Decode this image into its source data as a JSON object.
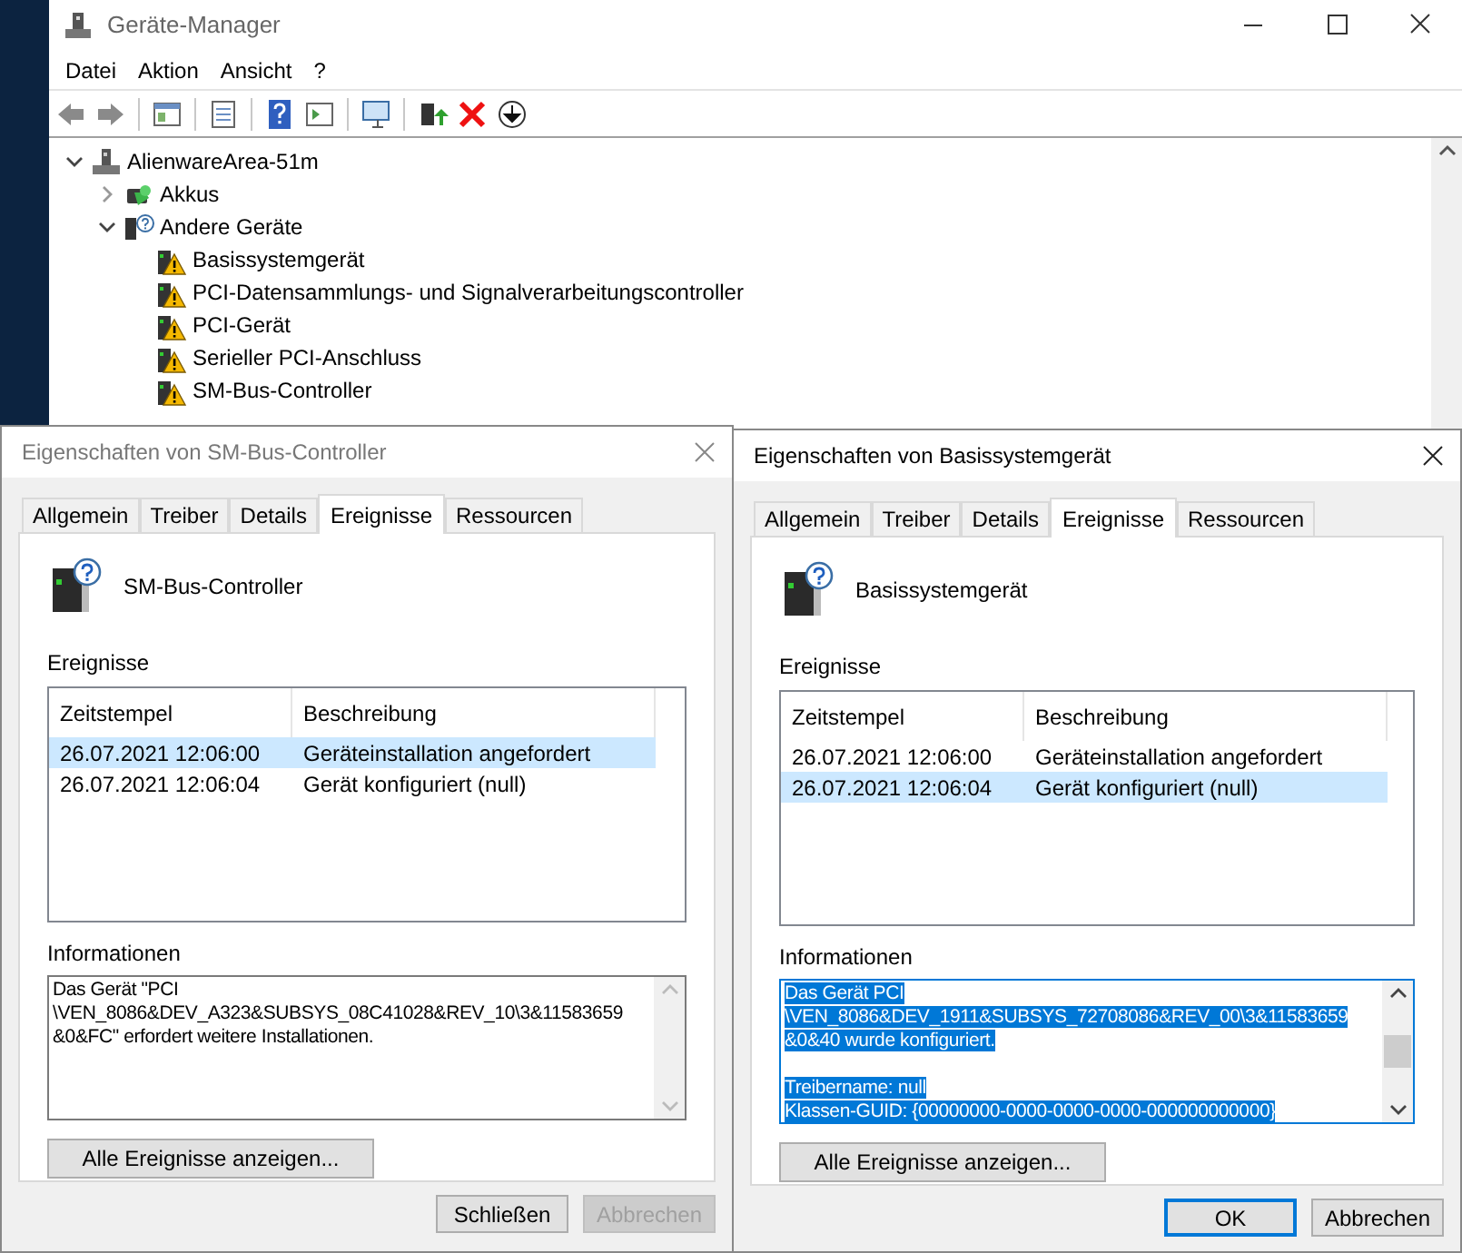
{
  "window": {
    "title": "Geräte-Manager"
  },
  "menu": [
    "Datei",
    "Aktion",
    "Ansicht",
    "?"
  ],
  "tree": {
    "label": "AlienwareArea-51m",
    "kind": "computer",
    "expanded": true,
    "children": [
      {
        "label": "Akkus",
        "kind": "battery",
        "expanded": false
      },
      {
        "label": "Andere Geräte",
        "kind": "unknown",
        "expanded": true,
        "children": [
          {
            "label": "Basissystemgerät",
            "kind": "warning"
          },
          {
            "label": "PCI-Datensammlungs- und Signalverarbeitungscontroller",
            "kind": "warning"
          },
          {
            "label": "PCI-Gerät",
            "kind": "warning"
          },
          {
            "label": "Serieller PCI-Anschluss",
            "kind": "warning"
          },
          {
            "label": "SM-Bus-Controller",
            "kind": "warning"
          }
        ]
      }
    ]
  },
  "dialogs": [
    {
      "title": "Eigenschaften von SM-Bus-Controller",
      "tabs": [
        {
          "label": "Allgemein",
          "selected": false
        },
        {
          "label": "Treiber",
          "selected": false
        },
        {
          "label": "Details",
          "selected": false
        },
        {
          "label": "Ereignisse",
          "selected": true
        },
        {
          "label": "Ressourcen",
          "selected": false
        }
      ],
      "device_name": "SM-Bus-Controller",
      "events_label": "Ereignisse",
      "columns": [
        "Zeitstempel",
        "Beschreibung"
      ],
      "rows": [
        {
          "timestamp": "26.07.2021 12:06:00",
          "description": "Geräteinstallation angefordert",
          "selected": true
        },
        {
          "timestamp": "26.07.2021 12:06:04",
          "description": "Gerät konfiguriert (null)",
          "selected": false
        }
      ],
      "info_label": "Informationen",
      "info_selected": false,
      "info_paragraphs": [
        [
          "Das Gerät \"PCI",
          "\\VEN_8086&DEV_A323&SUBSYS_08C41028&REV_10\\3&11583659",
          "&0&FC\" erfordert weitere Installationen."
        ]
      ],
      "show_all_button": "Alle Ereignisse anzeigen...",
      "buttons": [
        {
          "label": "Schließen",
          "disabled": false,
          "default": false
        },
        {
          "label": "Abbrechen",
          "disabled": true,
          "default": false
        }
      ]
    },
    {
      "title": "Eigenschaften von Basissystemgerät",
      "tabs": [
        {
          "label": "Allgemein",
          "selected": false
        },
        {
          "label": "Treiber",
          "selected": false
        },
        {
          "label": "Details",
          "selected": false
        },
        {
          "label": "Ereignisse",
          "selected": true
        },
        {
          "label": "Ressourcen",
          "selected": false
        }
      ],
      "device_name": "Basissystemgerät",
      "events_label": "Ereignisse",
      "columns": [
        "Zeitstempel",
        "Beschreibung"
      ],
      "rows": [
        {
          "timestamp": "26.07.2021 12:06:00",
          "description": "Geräteinstallation angefordert",
          "selected": false
        },
        {
          "timestamp": "26.07.2021 12:06:04",
          "description": "Gerät konfiguriert (null)",
          "selected": true
        }
      ],
      "info_label": "Informationen",
      "info_selected": true,
      "info_paragraphs": [
        [
          "Das Gerät PCI",
          "\\VEN_8086&DEV_1911&SUBSYS_72708086&REV_00\\3&11583659",
          "&0&40 wurde konfiguriert."
        ],
        [
          "Treibername: null",
          "Klassen-GUID: {00000000-0000-0000-0000-000000000000}"
        ]
      ],
      "show_all_button": "Alle Ereignisse anzeigen...",
      "buttons": [
        {
          "label": "OK",
          "disabled": false,
          "default": true
        },
        {
          "label": "Abbrechen",
          "disabled": false,
          "default": false
        }
      ]
    }
  ]
}
